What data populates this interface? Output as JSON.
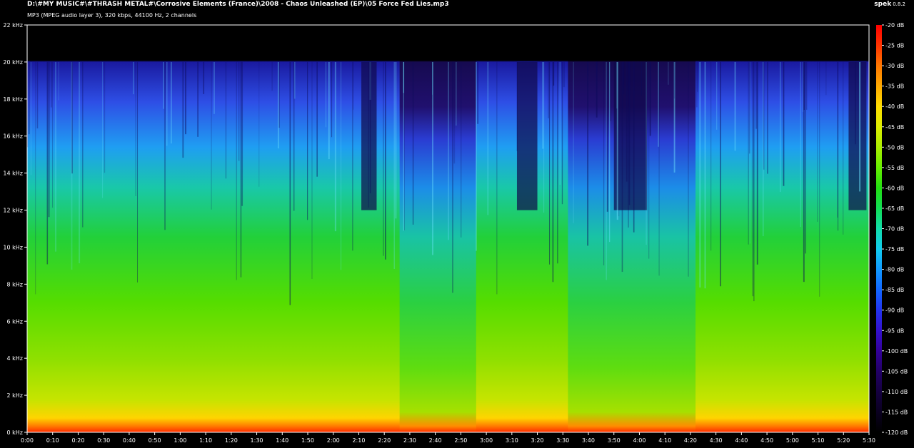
{
  "header": {
    "file_path": "D:\\#MY MUSIC#\\#THRASH METAL#\\Corrosive Elements (France)\\2008 - Chaos Unleashed (EP)\\05 Force Fed Lies.mp3",
    "stream_info": "MP3 (MPEG audio layer 3), 320 kbps, 44100 Hz, 2 channels"
  },
  "app": {
    "name": "spek",
    "version": "0.8.2"
  },
  "colors": {
    "background": "#000000",
    "text": "#ffffff",
    "axis": "#ffffff"
  },
  "frequency_axis": {
    "labels": [
      "22 kHz",
      "20 kHz",
      "18 kHz",
      "16 kHz",
      "14 kHz",
      "12 kHz",
      "10 kHz",
      "8 kHz",
      "6 kHz",
      "4 kHz",
      "2 kHz",
      "0 kHz"
    ],
    "max_khz": 22,
    "min_khz": 0
  },
  "time_axis": {
    "labels": [
      "0:00",
      "0:10",
      "0:20",
      "0:30",
      "0:40",
      "0:50",
      "1:00",
      "1:10",
      "1:20",
      "1:30",
      "1:40",
      "1:50",
      "2:00",
      "2:10",
      "2:20",
      "2:30",
      "2:40",
      "2:50",
      "3:00",
      "3:10",
      "3:20",
      "3:30",
      "3:40",
      "3:50",
      "4:00",
      "4:10",
      "4:20",
      "4:30",
      "4:40",
      "4:50",
      "5:00",
      "5:10",
      "5:20",
      "5:30"
    ],
    "duration_seconds": 330
  },
  "db_scale": {
    "labels": [
      "-20 dB",
      "-25 dB",
      "-30 dB",
      "-35 dB",
      "-40 dB",
      "-45 dB",
      "-50 dB",
      "-55 dB",
      "-60 dB",
      "-65 dB",
      "-70 dB",
      "-75 dB",
      "-80 dB",
      "-85 dB",
      "-90 dB",
      "-95 dB",
      "-100 dB",
      "-105 dB",
      "-110 dB",
      "-115 dB",
      "-120 dB"
    ],
    "palette": [
      "#ff0000",
      "#ff3300",
      "#ff7700",
      "#ffaa00",
      "#ffdd00",
      "#ddee00",
      "#aaee00",
      "#66ee00",
      "#22dd11",
      "#11dd55",
      "#11ddaa",
      "#11ccee",
      "#1199ff",
      "#1166ff",
      "#2233ee",
      "#3311cc",
      "#330099",
      "#220066",
      "#150040",
      "#0a0020",
      "#000000"
    ]
  },
  "spectrogram": {
    "cutoff_khz": 20,
    "dim_regions_seconds": [
      [
        131,
        137
      ],
      [
        192,
        200
      ],
      [
        230,
        243
      ],
      [
        322,
        329
      ]
    ],
    "quiet_regions_seconds": [
      [
        146,
        176
      ],
      [
        212,
        262
      ]
    ]
  }
}
